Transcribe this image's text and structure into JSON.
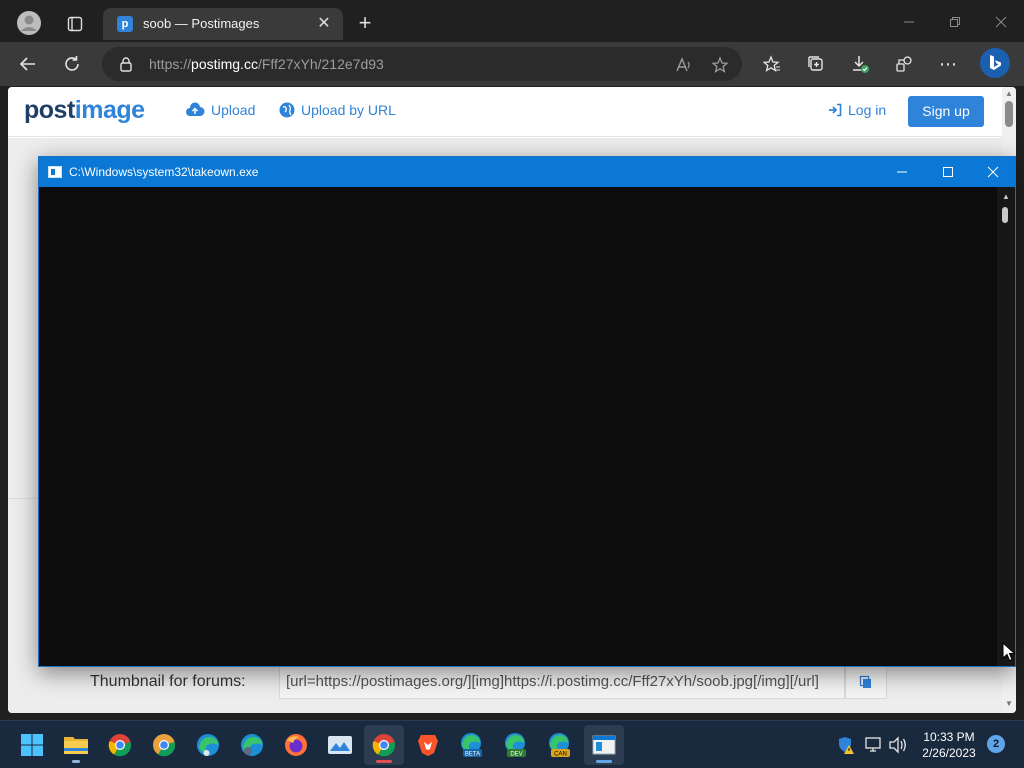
{
  "browser": {
    "tab_title": "soob — Postimages",
    "tab_favicon_letter": "p",
    "url_prefix": "https://",
    "url_host": "postimg.cc",
    "url_path": "/Fff27xYh/212e7d93"
  },
  "site": {
    "logo_part1": "post",
    "logo_part2": "image",
    "upload_label": "Upload",
    "upload_url_label": "Upload by URL",
    "login_label": "Log in",
    "signup_label": "Sign up",
    "thumbnail_label": "Thumbnail for forums:",
    "thumbnail_value": "[url=https://postimages.org/][img]https://i.postimg.cc/Fff27xYh/soob.jpg[/img][/url]"
  },
  "console": {
    "title": "C:\\Windows\\system32\\takeown.exe"
  },
  "taskbar": {
    "apps": [
      "start",
      "file-explorer",
      "chrome",
      "chrome-canary",
      "edge",
      "edge-profile",
      "firefox",
      "photos",
      "chrome",
      "brave",
      "edge-beta",
      "edge-dev",
      "edge-canary",
      "console"
    ],
    "badge_labels": {
      "beta": "BETA",
      "dev": "DEV",
      "can": "CAN"
    },
    "time": "10:33 PM",
    "date": "2/26/2023",
    "notification_count": "2"
  },
  "colors": {
    "accent": "#2f83d9",
    "console_title_bg": "#0a78d4",
    "taskbar_bg": "#1a2a3e"
  }
}
